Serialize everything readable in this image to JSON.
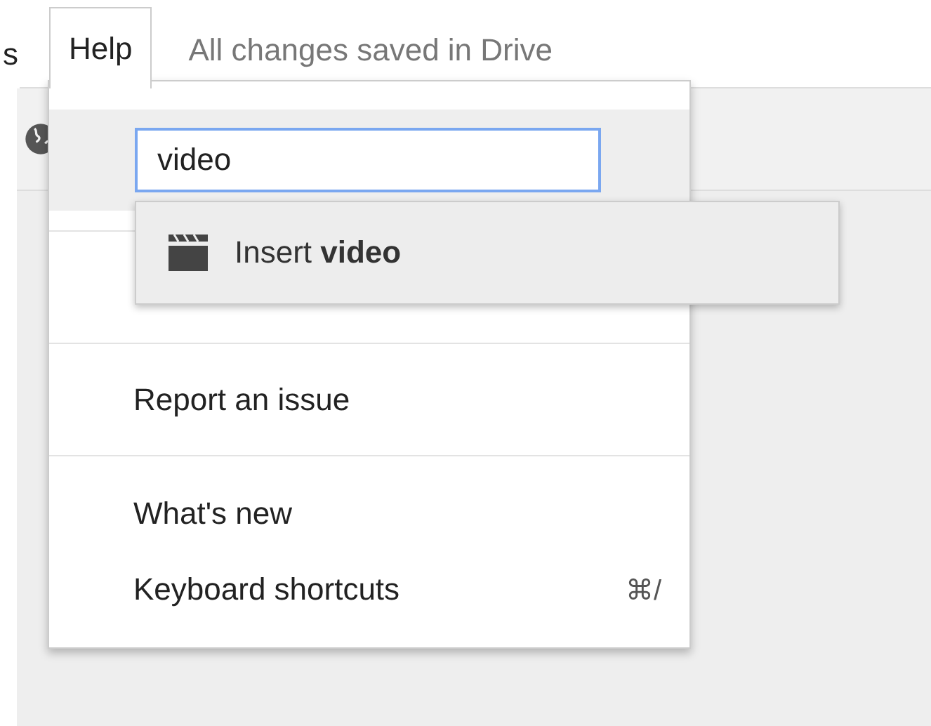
{
  "menubar": {
    "items": [
      {
        "label": "s",
        "selected": false
      },
      {
        "label": "Help",
        "selected": true
      }
    ],
    "status": "All changes saved in Drive"
  },
  "help_menu": {
    "search": {
      "value": "video"
    },
    "suggestion": {
      "label": "Insert **video**"
    },
    "sections": [
      [
        {
          "label": "Report an issue"
        }
      ],
      [
        {
          "label": "What's new"
        },
        {
          "label": "Keyboard shortcuts",
          "shortcut": "⌘/"
        }
      ]
    ]
  }
}
